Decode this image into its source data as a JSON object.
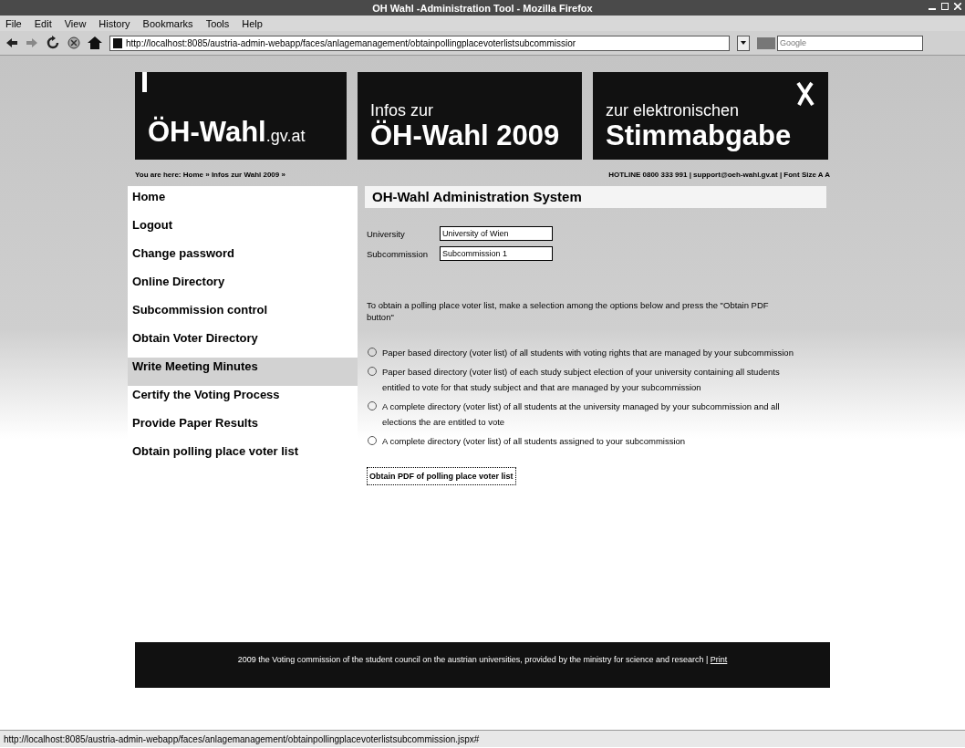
{
  "window": {
    "title": "OH Wahl -Administration Tool - Mozilla Firefox"
  },
  "menu": [
    "File",
    "Edit",
    "View",
    "History",
    "Bookmarks",
    "Tools",
    "Help"
  ],
  "address_bar": {
    "value": "http://localhost:8085/austria-admin-webapp/faces/anlagemanagement/obtainpollingplacevoterlistsubcommissior"
  },
  "search": {
    "placeholder": "Google"
  },
  "banners": [
    {
      "kind": "logo",
      "main": "ÖH-Wahl",
      "suffix": ".gv.at"
    },
    {
      "kind": "info",
      "top": "Infos zur",
      "main": "ÖH-Wahl 2009"
    },
    {
      "kind": "vote",
      "top": "zur elektronischen",
      "main": "Stimmabgabe"
    }
  ],
  "breadcrumb": "You are here: Home » Infos zur Wahl 2009 »",
  "hotline": "HOTLINE 0800 333 991 | support@oeh-wahl.gv.at | Font Size A A",
  "sidebar": {
    "items": [
      {
        "label": "Home",
        "selected": false
      },
      {
        "label": "Logout",
        "selected": false
      },
      {
        "label": "Change password",
        "selected": false
      },
      {
        "label": "Online Directory",
        "selected": false
      },
      {
        "label": "Subcommission control",
        "selected": false
      },
      {
        "label": "Obtain Voter Directory",
        "selected": false
      },
      {
        "label": "Write Meeting Minutes",
        "selected": true
      },
      {
        "label": "Certify the Voting Process",
        "selected": false
      },
      {
        "label": "Provide Paper Results",
        "selected": false
      },
      {
        "label": "Obtain polling place voter list",
        "selected": false
      }
    ]
  },
  "main": {
    "title": "OH-Wahl Administration System",
    "fields": [
      {
        "label": "University",
        "value": "University of Wien"
      },
      {
        "label": "Subcommission",
        "value": "Subcommission 1"
      }
    ],
    "instructions": "To obtain a polling place voter list, make a selection among the options below and press the \"Obtain PDF button\"",
    "options": [
      {
        "label": "Paper based directory (voter list) of all students with voting rights that are managed by your subcommission",
        "selected": false
      },
      {
        "label": "Paper based directory (voter list) of each study subject election of your university containing all students entitled to vote for that study subject and that are managed by your subcommission",
        "selected": false
      },
      {
        "label": "A complete directory (voter list) of all students at the university managed by your subcommission and all elections the are entitled to vote",
        "selected": false
      },
      {
        "label": "A complete directory (voter list) of all students assigned to your subcommission",
        "selected": false
      }
    ],
    "button": "Obtain PDF of polling place voter list"
  },
  "footer": {
    "text": "2009 the Voting commission of the student council on the austrian universities, provided by the ministry for science and research |",
    "link": "Print"
  },
  "status_bar": "http://localhost:8085/austria-admin-webapp/faces/anlagemanagement/obtainpollingplacevoterlistsubcommission.jspx#"
}
